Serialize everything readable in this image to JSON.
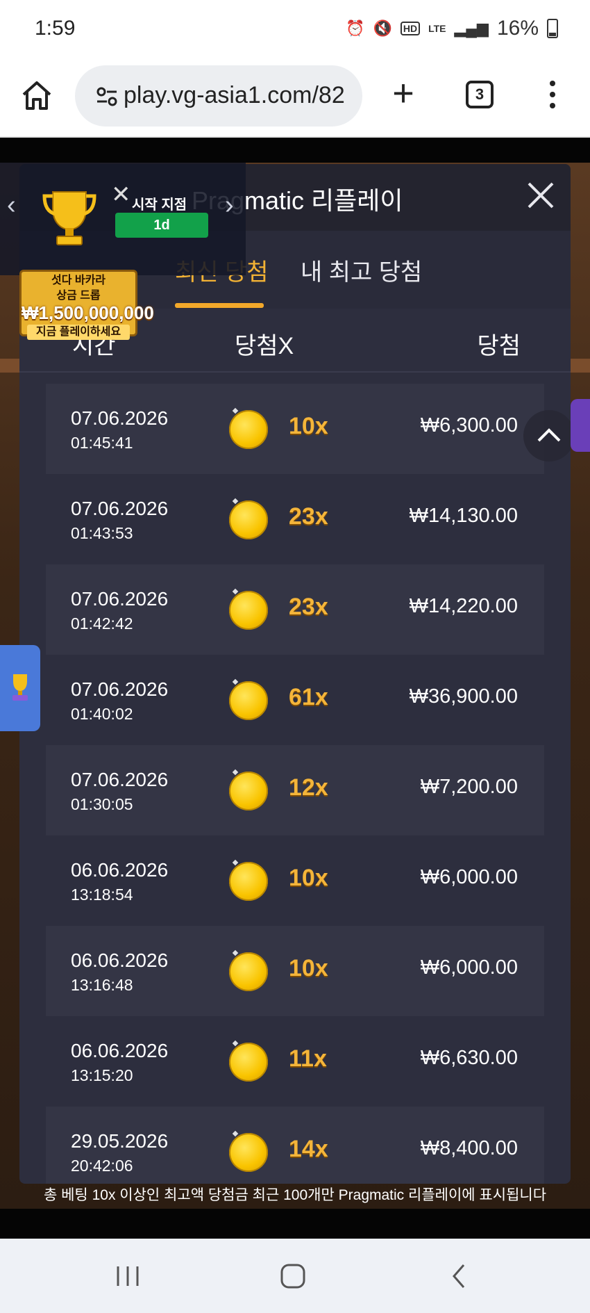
{
  "status_bar": {
    "time": "1:59",
    "lte_label": "LTE",
    "battery": "16%"
  },
  "browser": {
    "url": "play.vg-asia1.com/82",
    "tab_count": "3"
  },
  "promo": {
    "start_label": "시작 지점",
    "days_badge": "1d",
    "banner_line1": "섯다 바카라",
    "banner_line2": "상금 드롭",
    "banner_amount": "₩1,500,000,000",
    "banner_cta": "지금 플레이하세요"
  },
  "panel": {
    "title": "Pragmatic 리플레이",
    "tabs": [
      {
        "label": "최신 당첨",
        "active": true
      },
      {
        "label": "내 최고 당첨",
        "active": false
      }
    ],
    "columns": {
      "time": "시간",
      "multiplier": "당첨X",
      "win": "당첨"
    },
    "rows": [
      {
        "date": "07.06.2026",
        "time": "01:45:41",
        "mult": "10x",
        "win": "₩6,300.00"
      },
      {
        "date": "07.06.2026",
        "time": "01:43:53",
        "mult": "23x",
        "win": "₩14,130.00"
      },
      {
        "date": "07.06.2026",
        "time": "01:42:42",
        "mult": "23x",
        "win": "₩14,220.00"
      },
      {
        "date": "07.06.2026",
        "time": "01:40:02",
        "mult": "61x",
        "win": "₩36,900.00"
      },
      {
        "date": "07.06.2026",
        "time": "01:30:05",
        "mult": "12x",
        "win": "₩7,200.00"
      },
      {
        "date": "06.06.2026",
        "time": "13:18:54",
        "mult": "10x",
        "win": "₩6,000.00"
      },
      {
        "date": "06.06.2026",
        "time": "13:16:48",
        "mult": "10x",
        "win": "₩6,000.00"
      },
      {
        "date": "06.06.2026",
        "time": "13:15:20",
        "mult": "11x",
        "win": "₩6,630.00"
      },
      {
        "date": "29.05.2026",
        "time": "20:42:06",
        "mult": "14x",
        "win": "₩8,400.00"
      }
    ],
    "footer_note": "총 베팅 10x 이상인 최고액 당첨금 최근 100개만 Pragmatic 리플레이에 표시됩니다"
  },
  "icons": [
    "home-icon",
    "tune-icon",
    "plus-icon",
    "tabs-icon",
    "more-icon",
    "close-icon",
    "chevron-up-icon",
    "trophy-icon",
    "coin-icon",
    "recents-icon",
    "home-nav-icon",
    "back-icon"
  ],
  "colors": {
    "accent": "#f2b234",
    "panel": "#2d2e3e",
    "badge_green": "#12a14a"
  }
}
